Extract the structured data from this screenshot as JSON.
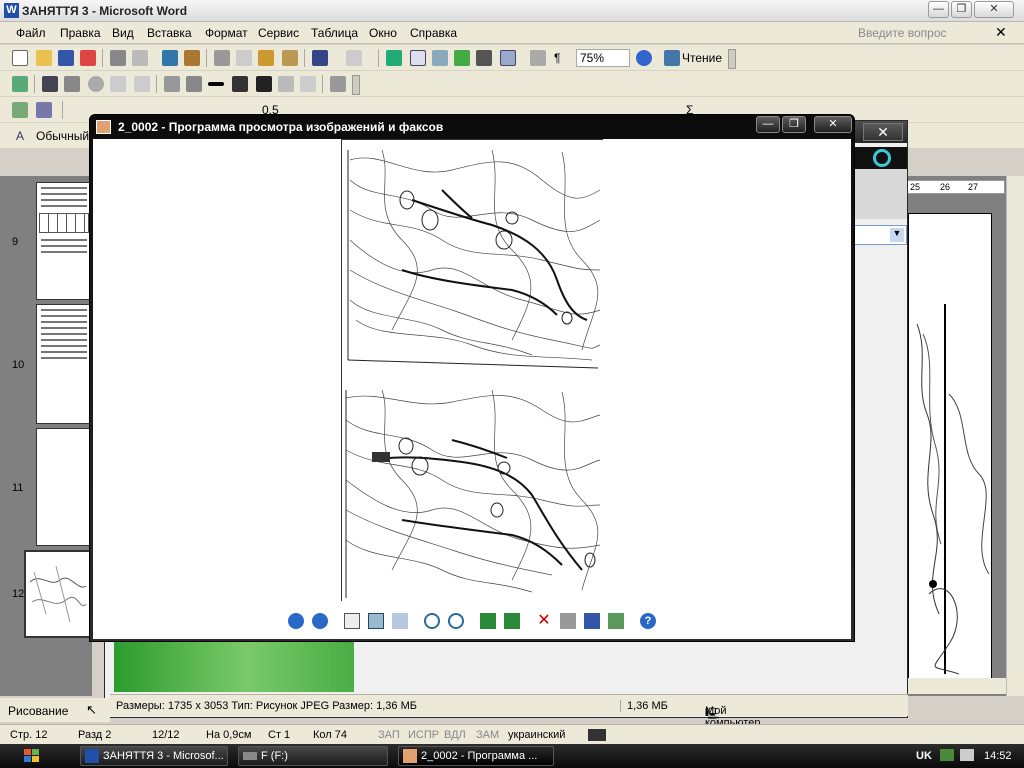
{
  "word": {
    "title": "ЗАНЯТТЯ 3 - Microsoft Word",
    "menu": [
      "Файл",
      "Правка",
      "Вид",
      "Вставка",
      "Формат",
      "Сервис",
      "Таблица",
      "Окно",
      "Справка"
    ],
    "ask_placeholder": "Введите вопрос",
    "zoom": "75%",
    "reading_btn": "Чтение",
    "style_label": "Обычный",
    "line_width": "0,5",
    "page_numbers": [
      "9",
      "10",
      "11",
      "12"
    ],
    "ruler_marks": [
      "25",
      "26",
      "27"
    ],
    "drawing_label": "Рисование",
    "status": {
      "page": "Стр. 12",
      "section": "Разд 2",
      "pages": "12/12",
      "at": "На 0,9см",
      "line": "Ст 1",
      "col": "Кол 74",
      "rec": "ЗАП",
      "trk": "ИСПР",
      "ext": "ВДЛ",
      "ovr": "ЗАМ",
      "lang": "украинский"
    }
  },
  "viewer": {
    "title": "2_0002 - Программа просмотра изображений и факсов",
    "status_info": "Размеры: 1735 x 3053 Тип: Рисунок JPEG Размер: 1,36 МБ",
    "status_size": "1,36 МБ",
    "status_location": "Мой компьютер"
  },
  "taskbar": {
    "items": [
      {
        "label": "ЗАНЯТТЯ 3 - Microsof..."
      },
      {
        "label": "F (F:)"
      },
      {
        "label": "2_0002 - Программа ..."
      }
    ],
    "lang": "UK",
    "clock": "14:52"
  },
  "colors": {
    "viewer_frame": "#1a1a1a",
    "toolbar_bg": "#ece9d8",
    "map_ink": "#222222"
  }
}
